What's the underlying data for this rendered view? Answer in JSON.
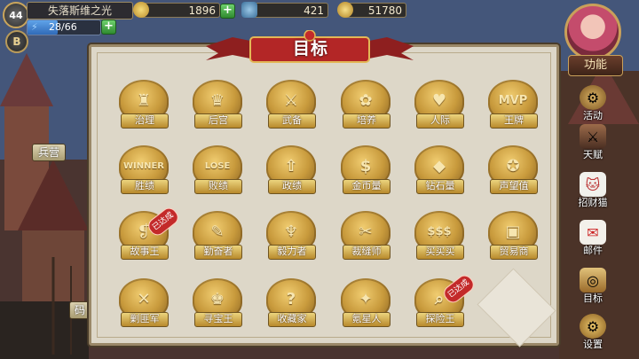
{
  "player": {
    "level": "44",
    "badge": "B",
    "name": "失落斯维之光",
    "energy": "28/66",
    "energy_fraction": 0.42
  },
  "resources": [
    {
      "icon": "coin-icon",
      "value": "1896"
    },
    {
      "icon": "potion-icon",
      "value": "421"
    },
    {
      "icon": "gem-icon",
      "value": "51780"
    }
  ],
  "left_labels": {
    "barracks": "兵营",
    "dock": "码"
  },
  "panel_title": "目标",
  "sidebar": {
    "function": "功能",
    "items": [
      {
        "label": "活动",
        "icon": "gear-medal-icon"
      },
      {
        "label": "天赋",
        "icon": "talent-icon"
      },
      {
        "label": "招财猫",
        "icon": "lucky-cat-icon"
      },
      {
        "label": "邮件",
        "icon": "mail-icon"
      },
      {
        "label": "目标",
        "icon": "target-icon"
      },
      {
        "label": "设置",
        "icon": "settings-icon"
      }
    ]
  },
  "achievements": [
    {
      "label": "治理",
      "icon": "palace-icon",
      "glyph": "♜",
      "done": false
    },
    {
      "label": "后宫",
      "icon": "harem-icon",
      "glyph": "♛",
      "done": false
    },
    {
      "label": "武备",
      "icon": "sword-rank-icon",
      "glyph": "⚔",
      "done": false
    },
    {
      "label": "培养",
      "icon": "girls-icon",
      "glyph": "✿",
      "done": false
    },
    {
      "label": "人际",
      "icon": "heart-icon",
      "glyph": "♥",
      "done": false
    },
    {
      "label": "王牌",
      "icon": "mvp-icon",
      "glyph": "MVP",
      "done": false
    },
    {
      "label": "胜绩",
      "icon": "winner-icon",
      "glyph": "WINNER",
      "done": false
    },
    {
      "label": "败绩",
      "icon": "lose-icon",
      "glyph": "LOSE",
      "done": false
    },
    {
      "label": "政绩",
      "icon": "arrows-up-icon",
      "glyph": "⇧",
      "done": false
    },
    {
      "label": "金币量",
      "icon": "coins-icon",
      "glyph": "$",
      "done": false
    },
    {
      "label": "钻石量",
      "icon": "diamond-icon",
      "glyph": "◆",
      "done": false
    },
    {
      "label": "声望值",
      "icon": "reputation-icon",
      "glyph": "✪",
      "done": false
    },
    {
      "label": "故事王",
      "icon": "book-icon",
      "glyph": "❡",
      "done": true
    },
    {
      "label": "勤奋者",
      "icon": "tools-icon",
      "glyph": "✎",
      "done": false
    },
    {
      "label": "毅力者",
      "icon": "laurel-cup-icon",
      "glyph": "♆",
      "done": false
    },
    {
      "label": "裁缝师",
      "icon": "needle-icon",
      "glyph": "✂",
      "done": false
    },
    {
      "label": "买买买",
      "icon": "shopping-icon",
      "glyph": "$$$",
      "done": false
    },
    {
      "label": "贸易商",
      "icon": "trade-icon",
      "glyph": "▣",
      "done": false
    },
    {
      "label": "剿匪军",
      "icon": "crossed-swords-icon",
      "glyph": "✕",
      "done": false
    },
    {
      "label": "寻宝王",
      "icon": "treasure-hunter-icon",
      "glyph": "♚",
      "done": false
    },
    {
      "label": "收藏家",
      "icon": "collector-icon",
      "glyph": "?",
      "done": false
    },
    {
      "label": "氪星人",
      "icon": "treasure-chest-icon",
      "glyph": "✦",
      "done": false
    },
    {
      "label": "探险王",
      "icon": "explorer-icon",
      "glyph": "⌕",
      "done": true
    }
  ],
  "done_label": "已达成"
}
